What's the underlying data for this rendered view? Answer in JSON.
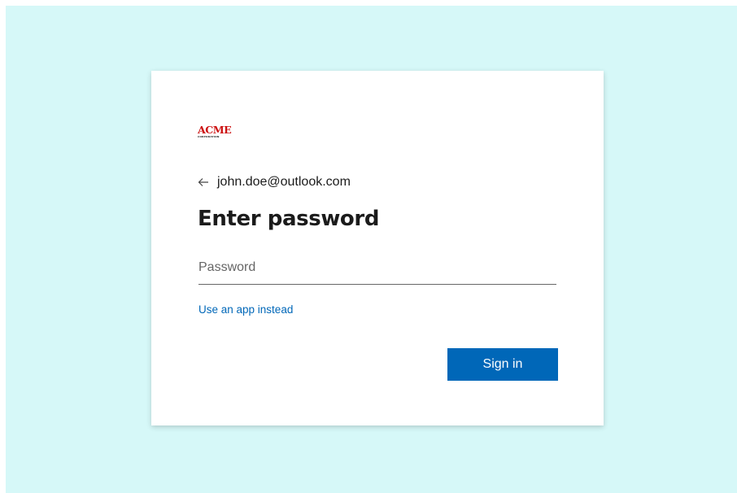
{
  "brand": {
    "logo_text": "ACME",
    "logo_subtext": "CORPORATION",
    "logo_color": "#cc1111"
  },
  "account": {
    "back_icon": "arrow-left-icon",
    "identity": "john.doe@outlook.com"
  },
  "page": {
    "title": "Enter password"
  },
  "form": {
    "password_value": "",
    "password_placeholder": "Password",
    "alternative_link": "Use an app instead",
    "submit_label": "Sign in"
  },
  "colors": {
    "background": "#d6f8f8",
    "card": "#ffffff",
    "primary": "#0067b8",
    "link": "#0067b8",
    "text": "#1b1b1b"
  }
}
